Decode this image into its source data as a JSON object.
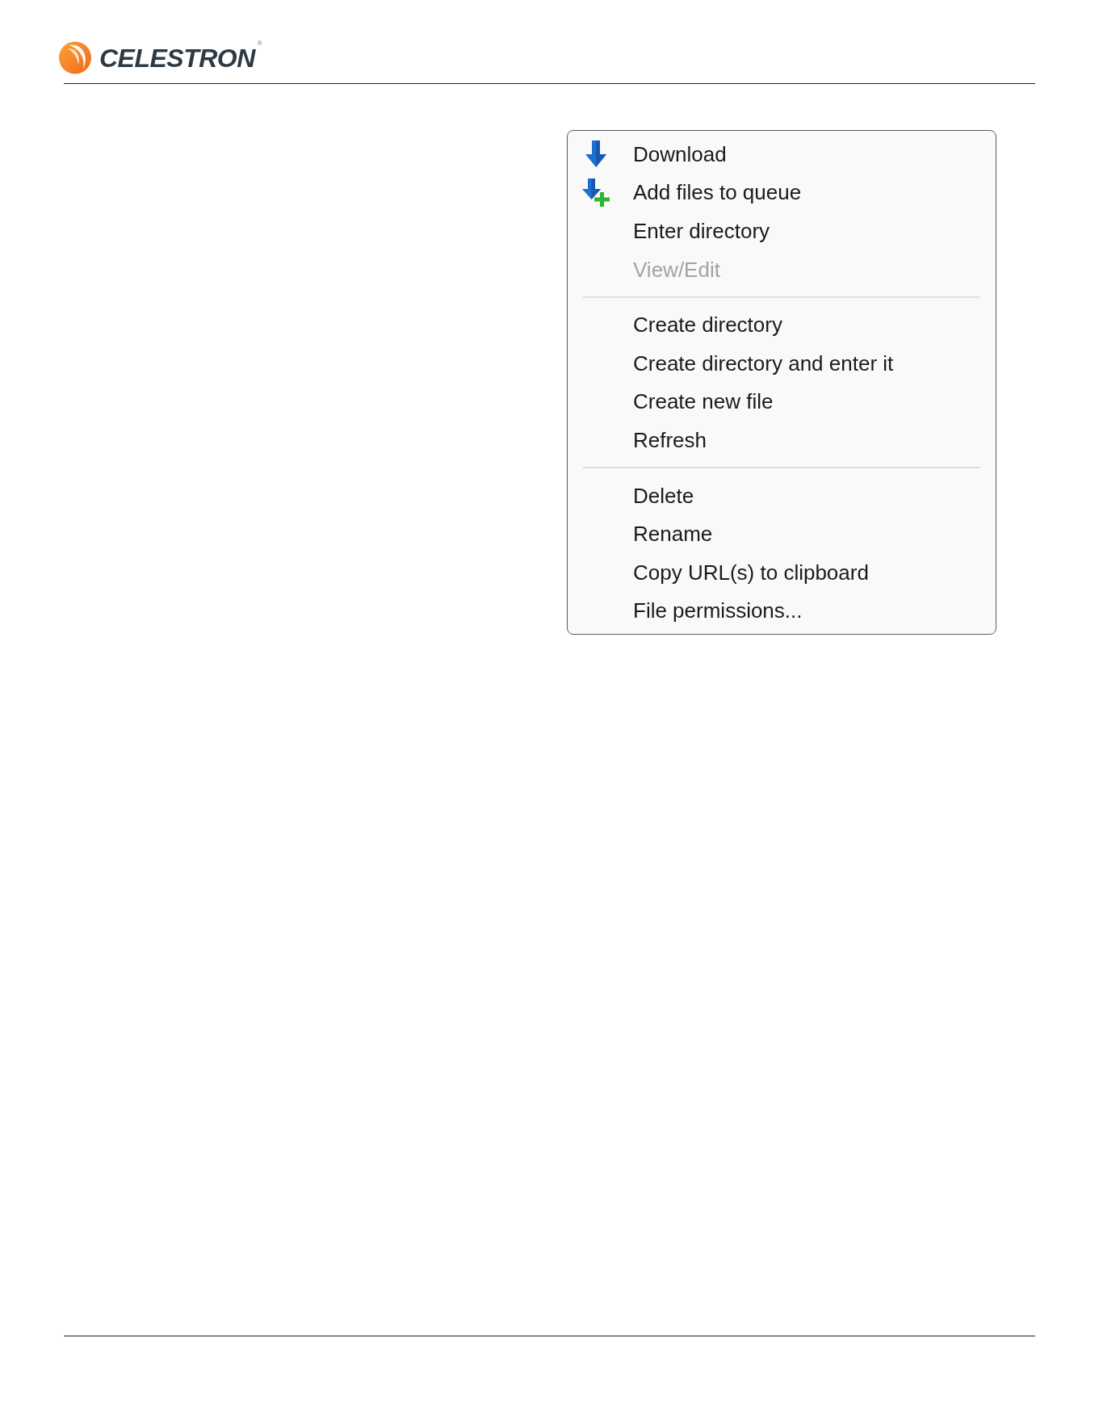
{
  "header": {
    "logo": {
      "wordmark": "CELESTRON",
      "registered_mark": "®"
    }
  },
  "context_menu": {
    "sections": [
      {
        "items": [
          {
            "label": "Download",
            "kind": "download",
            "disabled": false
          },
          {
            "label": "Add files to queue",
            "kind": "enqueue",
            "disabled": false
          },
          {
            "label": "Enter directory",
            "kind": "plain",
            "disabled": false
          },
          {
            "label": "View/Edit",
            "kind": "plain",
            "disabled": true
          }
        ]
      },
      {
        "items": [
          {
            "label": "Create directory",
            "kind": "plain",
            "disabled": false
          },
          {
            "label": "Create directory and enter it",
            "kind": "plain",
            "disabled": false
          },
          {
            "label": "Create new file",
            "kind": "plain",
            "disabled": false
          },
          {
            "label": "Refresh",
            "kind": "plain",
            "disabled": false
          }
        ]
      },
      {
        "items": [
          {
            "label": "Delete",
            "kind": "plain",
            "disabled": false
          },
          {
            "label": "Rename",
            "kind": "plain",
            "disabled": false
          },
          {
            "label": "Copy URL(s) to clipboard",
            "kind": "plain",
            "disabled": false
          },
          {
            "label": "File permissions...",
            "kind": "plain",
            "disabled": false
          }
        ]
      }
    ]
  }
}
